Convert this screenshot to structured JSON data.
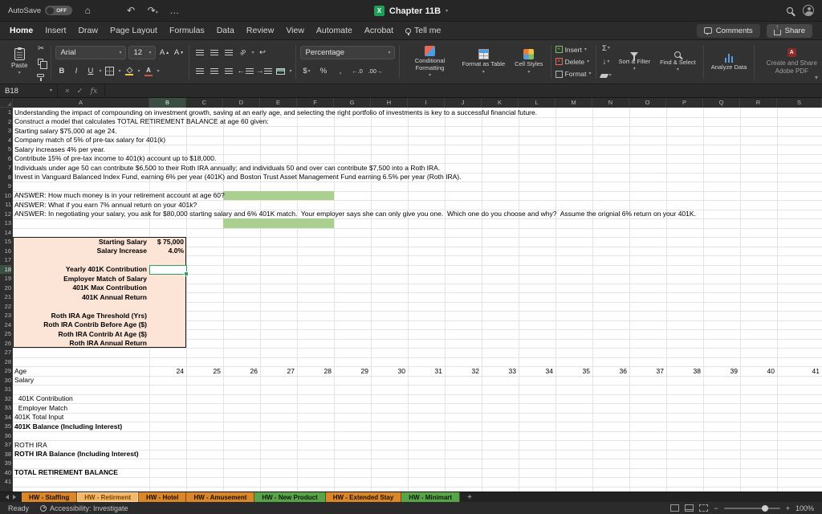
{
  "colors": {
    "selection": "#2f9e63",
    "answer_fill": "#a9d08e",
    "table_fill": "#fce4d6",
    "accent_green": "#1e9e57"
  },
  "titlebar": {
    "autosave_label": "AutoSave",
    "autosave_state": "OFF",
    "doc_title": "Chapter 11B"
  },
  "menu": {
    "tabs": [
      "Home",
      "Insert",
      "Draw",
      "Page Layout",
      "Formulas",
      "Data",
      "Review",
      "View",
      "Automate",
      "Acrobat"
    ],
    "tellme_label": "Tell me",
    "comments_label": "Comments",
    "share_label": "Share"
  },
  "ribbon": {
    "paste_label": "Paste",
    "font_name": "Arial",
    "font_size": "12",
    "number_format": "Percentage",
    "style_buttons": [
      "Conditional Formatting",
      "Format as Table",
      "Cell Styles"
    ],
    "cells_buttons": [
      "Insert",
      "Delete",
      "Format"
    ],
    "sort_filter_label": "Sort & Filter",
    "find_select_label": "Find & Select",
    "analyze_label": "Analyze Data",
    "adobe_label": "Create and Share Adobe PDF"
  },
  "formula_bar": {
    "cell_ref": "B18",
    "fx_label": "fx"
  },
  "sheet": {
    "col_names": [
      "A",
      "B",
      "C",
      "D",
      "E",
      "F",
      "G",
      "H",
      "I",
      "J",
      "K",
      "L",
      "M",
      "N",
      "O",
      "P",
      "Q",
      "R",
      "S"
    ],
    "row_count": 41,
    "selection": {
      "col": "B",
      "row": 18
    },
    "fills": [
      {
        "row": 10,
        "col": "D",
        "cols": 3,
        "color": "#a9d08e"
      },
      {
        "row": 13,
        "col": "D",
        "cols": 3,
        "color": "#a9d08e"
      }
    ],
    "block": {
      "row1": 15,
      "row2": 26,
      "col1": "A",
      "col2": "B",
      "color": "#fce4d6"
    },
    "cells": [
      {
        "r": 1,
        "c": "A",
        "t": "Understanding the impact of compounding on investment growth, saving at an early age, and selecting the right portfolio of investments is key to a successful financial future."
      },
      {
        "r": 2,
        "c": "A",
        "t": "Construct a model that calculates TOTAL RETIREMENT BALANCE at age 60 given:"
      },
      {
        "r": 3,
        "c": "A",
        "t": "Starting salary $75,000 at age 24."
      },
      {
        "r": 4,
        "c": "A",
        "t": "Company match of 5% of pre-tax salary for 401(k)"
      },
      {
        "r": 5,
        "c": "A",
        "t": "Salary increases 4% per year."
      },
      {
        "r": 6,
        "c": "A",
        "t": "Contribute 15% of pre-tax income to 401(k) account up to $18,000."
      },
      {
        "r": 7,
        "c": "A",
        "t": "Individuals under age 50 can contribute $6,500 to their Roth IRA annually; and individuals 50 and over can contribute $7,500 into a Roth IRA."
      },
      {
        "r": 8,
        "c": "A",
        "t": "Invest in Vanguard Balanced Index Fund, earning 6% per year (401K) and Boston Trust Asset Management Fund earning 6.5% per year (Roth IRA)."
      },
      {
        "r": 10,
        "c": "A",
        "t": "ANSWER: How much money is in your retirement account at age 60?"
      },
      {
        "r": 11,
        "c": "A",
        "t": "ANSWER: What if you earn 7% annual return on your 401k?"
      },
      {
        "r": 12,
        "c": "A",
        "t": "ANSWER: In negotiating your salary, you ask for $80,000 starting salary and 6% 401K match.  Your employer says she can only give you one.  Which one do you choose and why?  Assume the orignial 6% return on your 401K."
      },
      {
        "r": 15,
        "c": "A",
        "t": "Starting Salary",
        "s": "b r"
      },
      {
        "r": 15,
        "c": "B",
        "t": "$ 75,000",
        "s": "b r"
      },
      {
        "r": 16,
        "c": "A",
        "t": "Salary Increase",
        "s": "b r"
      },
      {
        "r": 16,
        "c": "B",
        "t": "4.0%",
        "s": "b r"
      },
      {
        "r": 18,
        "c": "A",
        "t": "Yearly 401K Contribution",
        "s": "b r"
      },
      {
        "r": 19,
        "c": "A",
        "t": "Employer Match of Salary",
        "s": "b r"
      },
      {
        "r": 20,
        "c": "A",
        "t": "401K Max Contribution",
        "s": "b r"
      },
      {
        "r": 21,
        "c": "A",
        "t": "401K Annual Return",
        "s": "b r"
      },
      {
        "r": 23,
        "c": "A",
        "t": "Roth IRA Age Threshold (Yrs)",
        "s": "b r"
      },
      {
        "r": 24,
        "c": "A",
        "t": "Roth IRA Contrib Before Age ($)",
        "s": "b r"
      },
      {
        "r": 25,
        "c": "A",
        "t": "Roth IRA Contrib At Age ($)",
        "s": "b r"
      },
      {
        "r": 26,
        "c": "A",
        "t": "Roth IRA Annual Return",
        "s": "b r"
      },
      {
        "r": 29,
        "c": "A",
        "t": "Age"
      },
      {
        "r": 29,
        "c": "B",
        "t": "24",
        "s": "r"
      },
      {
        "r": 29,
        "c": "C",
        "t": "25",
        "s": "r"
      },
      {
        "r": 29,
        "c": "D",
        "t": "26",
        "s": "r"
      },
      {
        "r": 29,
        "c": "E",
        "t": "27",
        "s": "r"
      },
      {
        "r": 29,
        "c": "F",
        "t": "28",
        "s": "r"
      },
      {
        "r": 29,
        "c": "G",
        "t": "29",
        "s": "r"
      },
      {
        "r": 29,
        "c": "H",
        "t": "30",
        "s": "r"
      },
      {
        "r": 29,
        "c": "I",
        "t": "31",
        "s": "r"
      },
      {
        "r": 29,
        "c": "J",
        "t": "32",
        "s": "r"
      },
      {
        "r": 29,
        "c": "K",
        "t": "33",
        "s": "r"
      },
      {
        "r": 29,
        "c": "L",
        "t": "34",
        "s": "r"
      },
      {
        "r": 29,
        "c": "M",
        "t": "35",
        "s": "r"
      },
      {
        "r": 29,
        "c": "N",
        "t": "36",
        "s": "r"
      },
      {
        "r": 29,
        "c": "O",
        "t": "37",
        "s": "r"
      },
      {
        "r": 29,
        "c": "P",
        "t": "38",
        "s": "r"
      },
      {
        "r": 29,
        "c": "Q",
        "t": "39",
        "s": "r"
      },
      {
        "r": 29,
        "c": "R",
        "t": "40",
        "s": "r"
      },
      {
        "r": 29,
        "c": "S",
        "t": "41",
        "s": "r"
      },
      {
        "r": 30,
        "c": "A",
        "t": "Salary"
      },
      {
        "r": 32,
        "c": "A",
        "t": "  401K Contribution"
      },
      {
        "r": 33,
        "c": "A",
        "t": "  Employer Match"
      },
      {
        "r": 34,
        "c": "A",
        "t": "401K Total Input"
      },
      {
        "r": 35,
        "c": "A",
        "t": "401K Balance (Including Interest)",
        "s": "b"
      },
      {
        "r": 37,
        "c": "A",
        "t": "ROTH IRA"
      },
      {
        "r": 38,
        "c": "A",
        "t": "ROTH IRA Balance (Including Interest)",
        "s": "b"
      },
      {
        "r": 40,
        "c": "A",
        "t": "TOTAL RETIREMENT BALANCE",
        "s": "b"
      }
    ]
  },
  "sheet_tabs": {
    "items": [
      {
        "label": "HW - Staffing",
        "bg": "#dd8628",
        "fg": "#191006",
        "active": false
      },
      {
        "label": "HW - Retirment",
        "bg": "#f3b968",
        "fg": "#7d3f00",
        "active": true
      },
      {
        "label": "HW - Hotel",
        "bg": "#dd8628",
        "fg": "#191006",
        "active": false
      },
      {
        "label": "HW - Amusement",
        "bg": "#dd8628",
        "fg": "#191006",
        "active": false
      },
      {
        "label": "HW - New Product",
        "bg": "#57a546",
        "fg": "#0d1a0a",
        "active": false
      },
      {
        "label": "HW - Extended Stay",
        "bg": "#dd8628",
        "fg": "#191006",
        "active": false
      },
      {
        "label": "HW - Minimart",
        "bg": "#57a546",
        "fg": "#0d1a0a",
        "active": false
      }
    ],
    "add_label": "+"
  },
  "status": {
    "ready_label": "Ready",
    "accessibility_label": "Accessibility: Investigate",
    "zoom_label": "100%"
  }
}
